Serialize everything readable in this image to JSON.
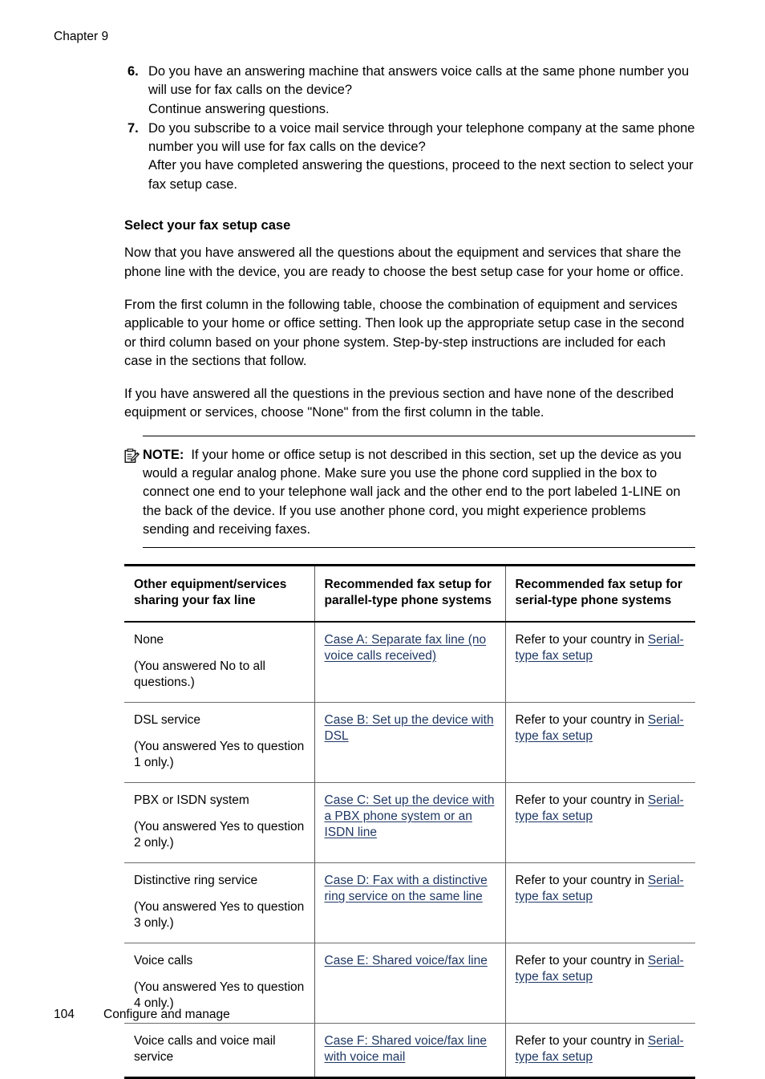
{
  "header": {
    "chapter": "Chapter 9"
  },
  "questions": [
    {
      "number": "6.",
      "question": "Do you have an answering machine that answers voice calls at the same phone number you will use for fax calls on the device?",
      "followup": "Continue answering questions."
    },
    {
      "number": "7.",
      "question": "Do you subscribe to a voice mail service through your telephone company at the same phone number you will use for fax calls on the device?",
      "followup": "After you have completed answering the questions, proceed to the next section to select your fax setup case."
    }
  ],
  "section": {
    "heading": "Select your fax setup case",
    "paragraphs": [
      "Now that you have answered all the questions about the equipment and services that share the phone line with the device, you are ready to choose the best setup case for your home or office.",
      "From the first column in the following table, choose the combination of equipment and services applicable to your home or office setting. Then look up the appropriate setup case in the second or third column based on your phone system. Step-by-step instructions are included for each case in the sections that follow.",
      "If you have answered all the questions in the previous section and have none of the described equipment or services, choose \"None\" from the first column in the table."
    ]
  },
  "note": {
    "icon": "note-clipboard-pencil-icon",
    "label": "NOTE:",
    "text": "If your home or office setup is not described in this section, set up the device as you would a regular analog phone. Make sure you use the phone cord supplied in the box to connect one end to your telephone wall jack and the other end to the port labeled 1-LINE on the back of the device. If you use another phone cord, you might experience problems sending and receiving faxes."
  },
  "table": {
    "headers": [
      "Other equipment/services sharing your fax line",
      "Recommended fax setup for parallel-type phone systems",
      "Recommended fax setup for serial-type phone systems"
    ],
    "rows": [
      {
        "equipment": "None",
        "equipment_sub": "(You answered No to all questions.)",
        "parallel_link": "Case A: Separate fax line (no voice calls received)",
        "serial_prefix": "Refer to your country in ",
        "serial_link": "Serial-type fax setup"
      },
      {
        "equipment": "DSL service",
        "equipment_sub": "(You answered Yes to question 1 only.)",
        "parallel_link": "Case B: Set up the device with DSL",
        "serial_prefix": "Refer to your country in ",
        "serial_link": "Serial-type fax setup"
      },
      {
        "equipment": "PBX or ISDN system",
        "equipment_sub": "(You answered Yes to question 2 only.)",
        "parallel_link": "Case C: Set up the device with a PBX phone system or an ISDN line",
        "serial_prefix": "Refer to your country in ",
        "serial_link": "Serial-type fax setup"
      },
      {
        "equipment": "Distinctive ring service",
        "equipment_sub": "(You answered Yes to question 3 only.)",
        "parallel_link": "Case D: Fax with a distinctive ring service on the same line",
        "serial_prefix": "Refer to your country in ",
        "serial_link": "Serial-type fax setup"
      },
      {
        "equipment": "Voice calls",
        "equipment_sub": "(You answered Yes to question 4 only.)",
        "parallel_link": "Case E: Shared voice/fax line",
        "serial_prefix": "Refer to your country in ",
        "serial_link": "Serial-type fax setup"
      },
      {
        "equipment": "Voice calls and voice mail service",
        "equipment_sub": "",
        "parallel_link": "Case F: Shared voice/fax line with voice mail",
        "serial_prefix": "Refer to your country in ",
        "serial_link": "Serial-type fax setup"
      }
    ]
  },
  "footer": {
    "page_number": "104",
    "text": "Configure and manage"
  },
  "colors": {
    "link": "#1f3864",
    "text": "#000000",
    "rule": "#58585a"
  }
}
